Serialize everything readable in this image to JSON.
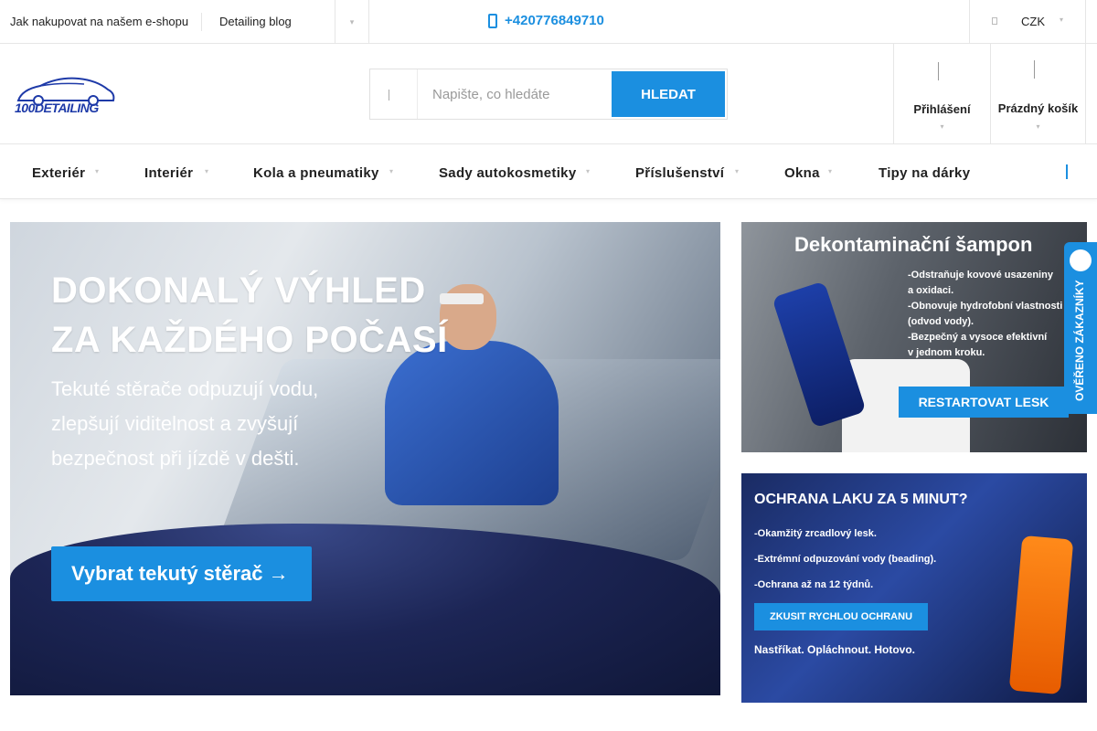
{
  "topbar": {
    "links": [
      "Jak nakupovat na našem e-shopu",
      "Detailing blog"
    ],
    "phone": "+420776849710",
    "currency": "CZK"
  },
  "header": {
    "logo_text": "100DETAILING",
    "search": {
      "placeholder": "Napište, co hledáte",
      "button": "HLEDAT"
    },
    "login_label": "Přihlášení",
    "cart_label": "Prázdný košík"
  },
  "nav": {
    "items": [
      "Exteriér",
      "Interiér",
      "Kola a pneumatiky",
      "Sady autokosmetiky",
      "Příslušenství",
      "Okna",
      "Tipy na dárky"
    ]
  },
  "hero": {
    "title_line1": "DOKONALÝ VÝHLED",
    "title_line2": "ZA KAŽDÉHO POČASÍ",
    "subtitle": "Tekuté stěrače odpuzují vodu, zlepšují viditelnost a zvyšují bezpečnost při jízdě v dešti.",
    "cta": "Vybrat tekutý stěrač →"
  },
  "banner1": {
    "title": "Dekontaminační šampon",
    "bullets": [
      "-Odstraňuje kovové usazeniny",
      "a oxidaci.",
      "-Obnovuje hydrofobní vlastnosti",
      "(odvod vody).",
      "-Bezpečný a vysoce efektivní",
      "v jednom kroku."
    ],
    "button": "RESTARTOVAT LESK"
  },
  "banner2": {
    "title": "OCHRANA LAKU ZA 5 MINUT?",
    "bullets": [
      "-Okamžitý zrcadlový lesk.",
      "-Extrémní odpuzování vody (beading).",
      "-Ochrana až na 12 týdnů."
    ],
    "button": "ZKUSIT RYCHLOU OCHRANU",
    "tagline": "Nastříkat. Opláchnout. Hotovo."
  },
  "verified_badge": "OVĚŘENO ZÁKAZNÍKY",
  "colors": {
    "accent": "#1b8fe0",
    "logo": "#1e3aa8"
  }
}
